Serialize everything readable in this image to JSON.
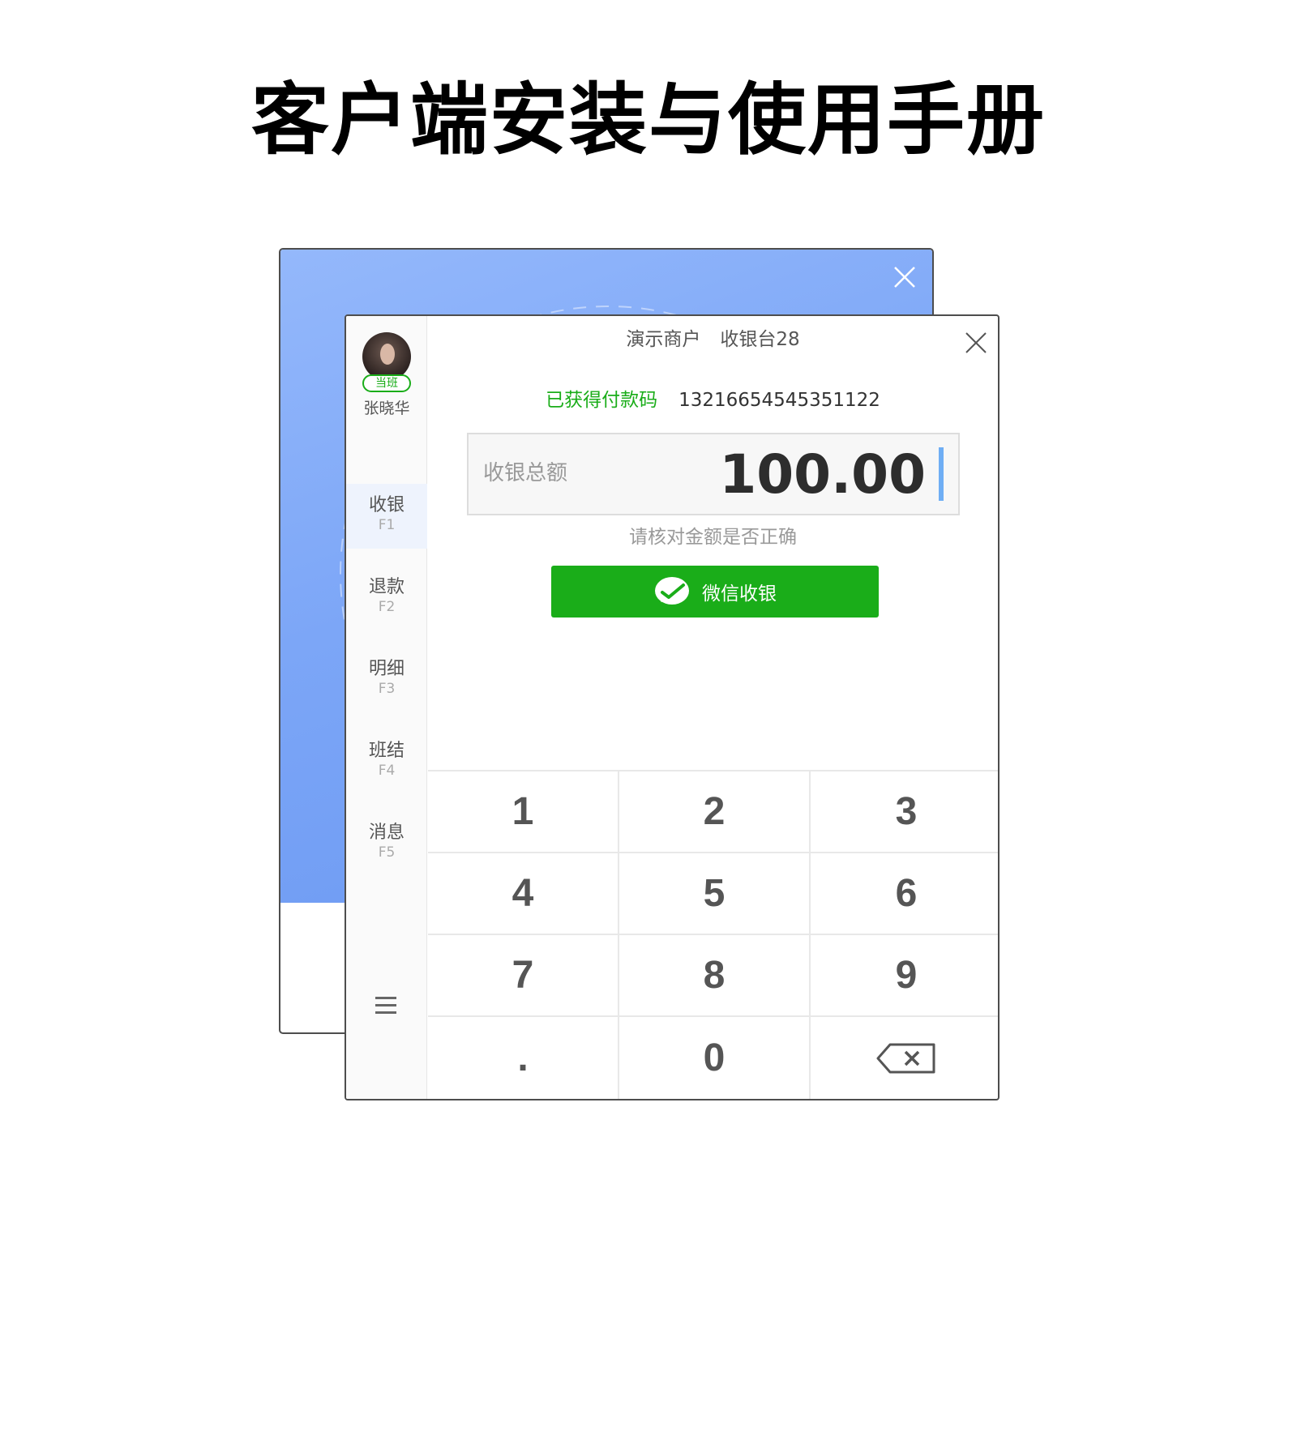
{
  "page_title": "客户端安装与使用手册",
  "sidebar": {
    "duty_badge": "当班",
    "user_name": "张晓华",
    "items": [
      {
        "label": "收银",
        "key": "F1",
        "active": true
      },
      {
        "label": "退款",
        "key": "F2",
        "active": false
      },
      {
        "label": "明细",
        "key": "F3",
        "active": false
      },
      {
        "label": "班结",
        "key": "F4",
        "active": false
      },
      {
        "label": "消息",
        "key": "F5",
        "active": false
      }
    ],
    "menu_icon": "hamburger-icon"
  },
  "header": {
    "merchant": "演示商户",
    "register": "收银台28"
  },
  "payment": {
    "code_status": "已获得付款码",
    "code_number": "13216654545351122",
    "amount_label": "收银总额",
    "amount_value": "100.00",
    "hint": "请核对金额是否正确",
    "wechat_button": "微信收银"
  },
  "keypad": {
    "keys": [
      "1",
      "2",
      "3",
      "4",
      "5",
      "6",
      "7",
      "8",
      "9",
      ".",
      "0",
      "backspace"
    ]
  },
  "colors": {
    "accent_green": "#1aad19",
    "back_window_blue": "#7ca6f7",
    "caret_blue": "#6faef4"
  }
}
